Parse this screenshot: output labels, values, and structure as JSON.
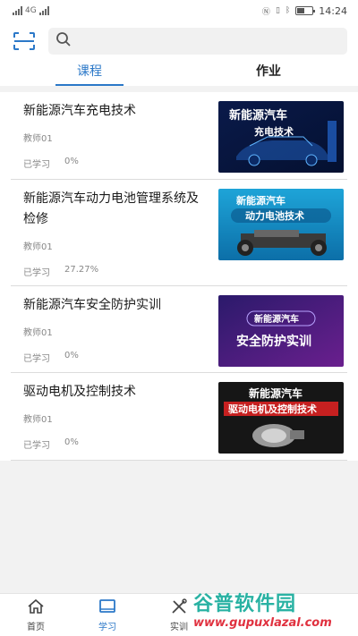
{
  "status_bar": {
    "carrier_hint": "4G",
    "time": "14:24"
  },
  "search": {
    "placeholder": ""
  },
  "tabs": [
    {
      "label": "课程",
      "active": true
    },
    {
      "label": "作业",
      "active": false
    }
  ],
  "courses": [
    {
      "title": "新能源汽车充电技术",
      "teacher": "教师01",
      "progress_label": "已学习",
      "progress_value": "0%",
      "thumb_line1": "新能源汽车",
      "thumb_line2": "充电技术",
      "thumb_theme": "blue-car"
    },
    {
      "title": "新能源汽车动力电池管理系统及检修",
      "teacher": "教师01",
      "progress_label": "已学习",
      "progress_value": "27.27%",
      "thumb_line1": "新能源汽车",
      "thumb_line2": "动力电池技术",
      "thumb_theme": "cyan-chassis"
    },
    {
      "title": "新能源汽车安全防护实训",
      "teacher": "教师01",
      "progress_label": "已学习",
      "progress_value": "0%",
      "thumb_line1": "新能源汽车",
      "thumb_line2": "安全防护实训",
      "thumb_theme": "purple"
    },
    {
      "title": "驱动电机及控制技术",
      "teacher": "教师01",
      "progress_label": "已学习",
      "progress_value": "0%",
      "thumb_line1": "新能源汽车",
      "thumb_line2": "驱动电机及控制技术",
      "thumb_theme": "dark-motor"
    }
  ],
  "bottom_nav": [
    {
      "label": "首页",
      "icon": "home-icon",
      "active": false
    },
    {
      "label": "学习",
      "icon": "book-icon",
      "active": true
    },
    {
      "label": "实训",
      "icon": "tools-icon",
      "active": false
    }
  ],
  "watermark": {
    "brand": "谷普软件园",
    "url": "www.gupuxlazal.com"
  },
  "colors": {
    "accent": "#2b78c8",
    "background": "#f2f2f2"
  }
}
